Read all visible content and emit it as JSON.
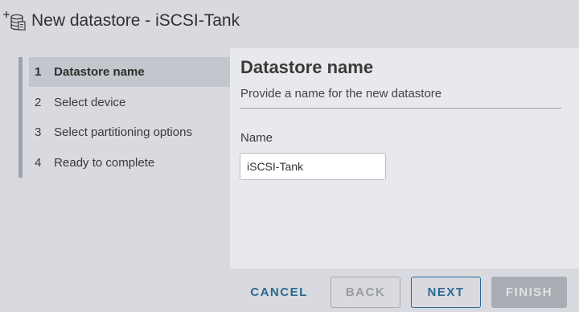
{
  "window": {
    "title": "New datastore - iSCSI-Tank",
    "icon": "new-datastore-icon"
  },
  "wizard": {
    "steps": [
      {
        "number": "1",
        "label": "Datastore name",
        "active": true
      },
      {
        "number": "2",
        "label": "Select device",
        "active": false
      },
      {
        "number": "3",
        "label": "Select partitioning options",
        "active": false
      },
      {
        "number": "4",
        "label": "Ready to complete",
        "active": false
      }
    ]
  },
  "content": {
    "title": "Datastore name",
    "subtitle": "Provide a name for the new datastore",
    "name_label": "Name",
    "name_value": "iSCSI-Tank"
  },
  "footer": {
    "cancel_label": "CANCEL",
    "back_label": "BACK",
    "next_label": "NEXT",
    "finish_label": "FINISH"
  },
  "colors": {
    "accent": "#2c6a91",
    "disabled": "#a9acb2"
  }
}
